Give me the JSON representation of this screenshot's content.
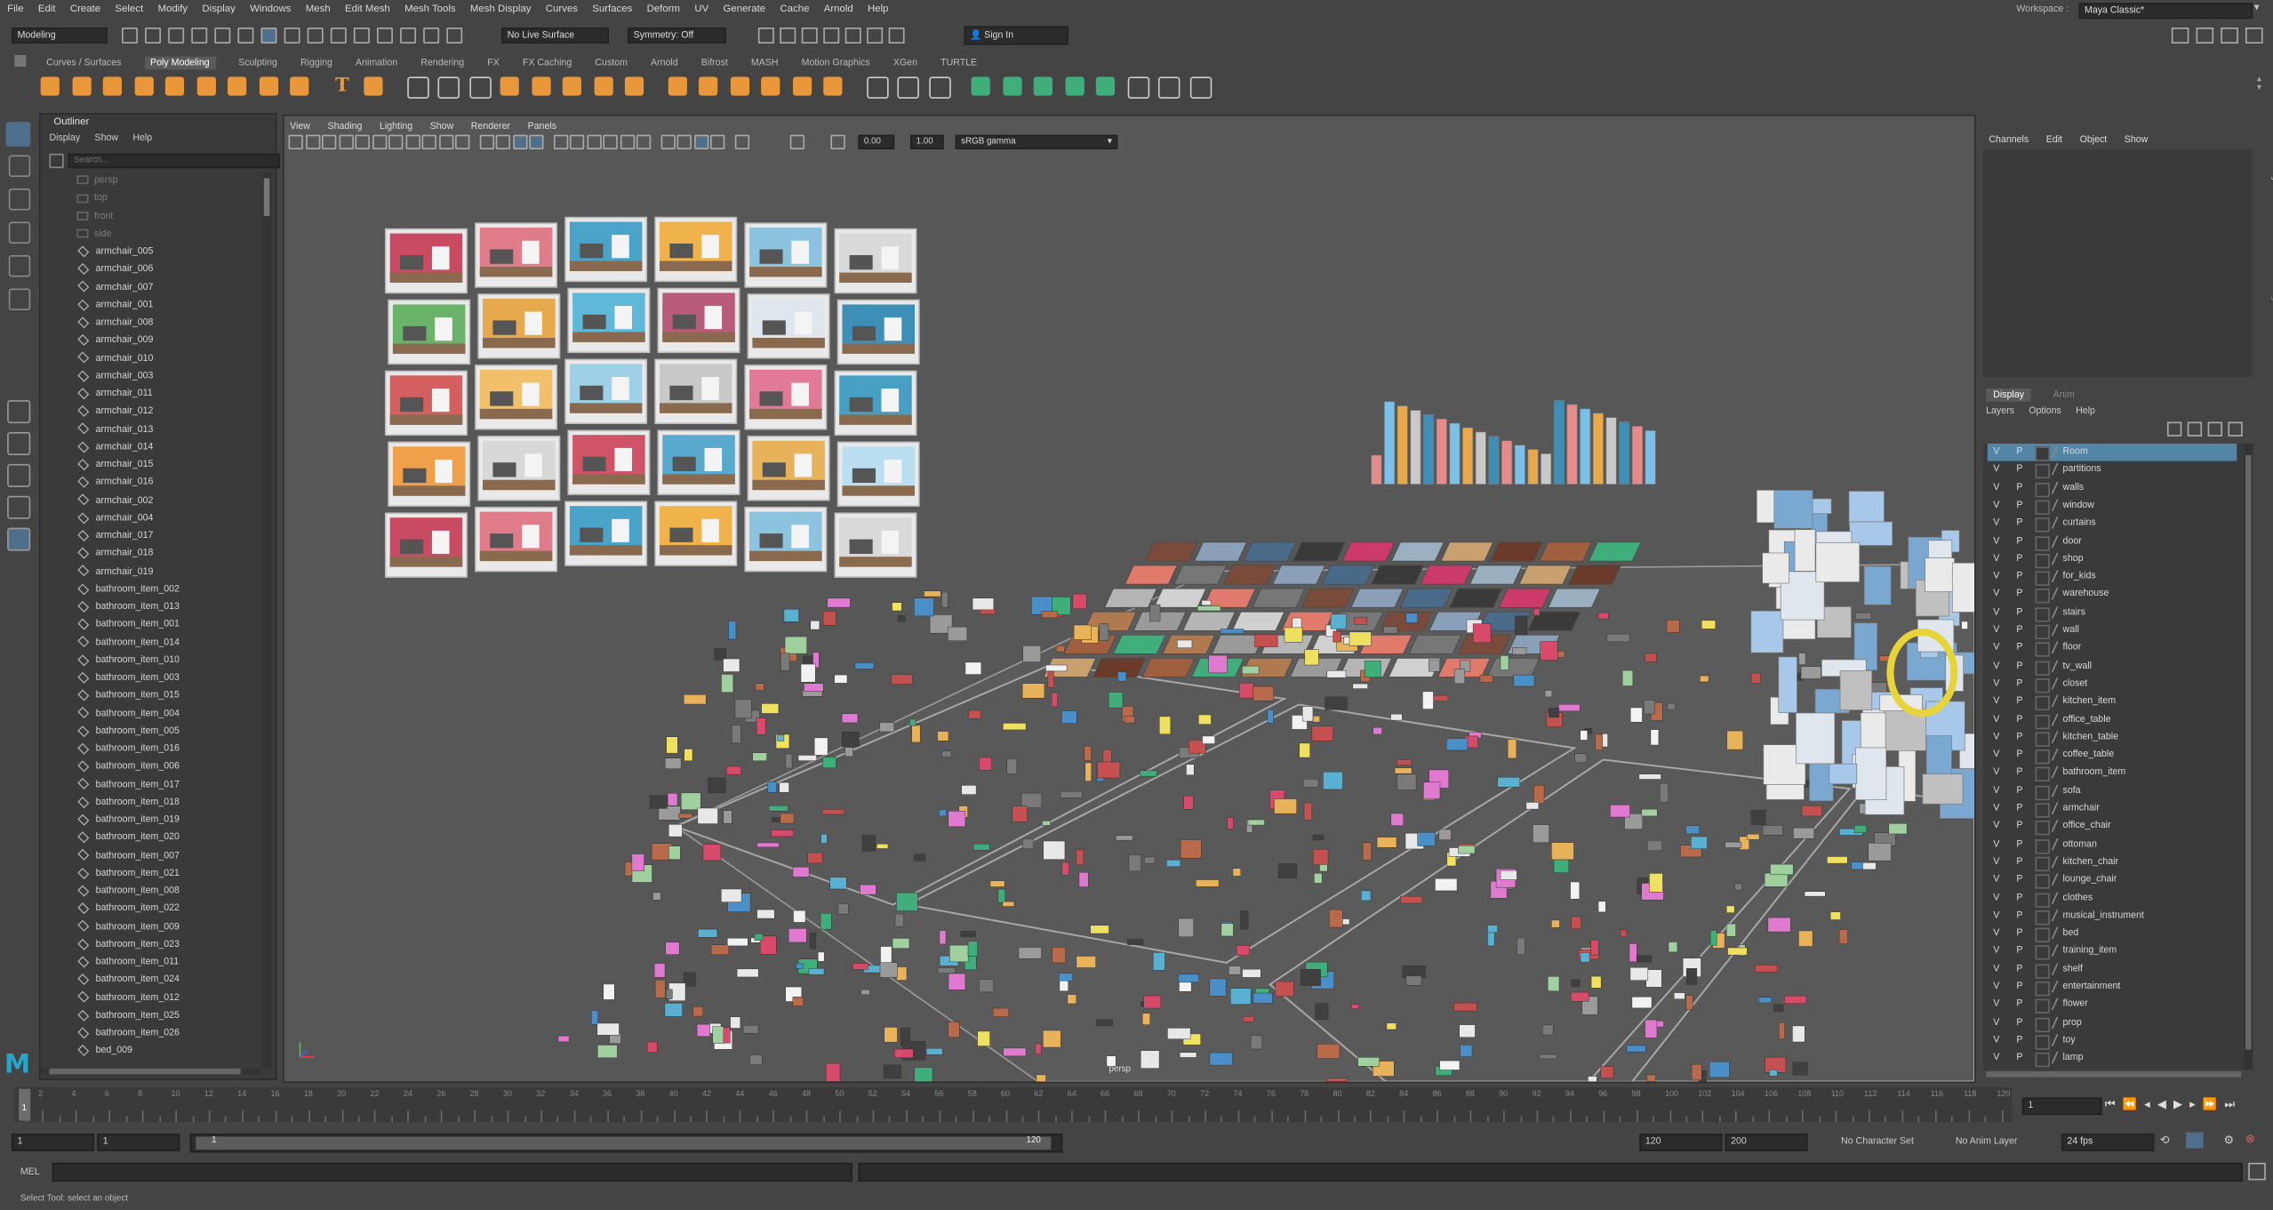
{
  "menu": [
    "File",
    "Edit",
    "Create",
    "Select",
    "Modify",
    "Display",
    "Windows",
    "Mesh",
    "Edit Mesh",
    "Mesh Tools",
    "Mesh Display",
    "Curves",
    "Surfaces",
    "Deform",
    "UV",
    "Generate",
    "Cache",
    "Arnold",
    "Help"
  ],
  "workspace": {
    "label": "Workspace :",
    "value": "Maya Classic*"
  },
  "statusline": {
    "mode": "Modeling",
    "live_surface": "No Live Surface",
    "symmetry": "Symmetry: Off",
    "sign_in": "Sign In"
  },
  "shelf_tabs": [
    "Curves / Surfaces",
    "Poly Modeling",
    "Sculpting",
    "Rigging",
    "Animation",
    "Rendering",
    "FX",
    "FX Caching",
    "Custom",
    "Arnold",
    "Bifrost",
    "MASH",
    "Motion Graphics",
    "XGen",
    "TURTLE"
  ],
  "shelf_active": "Poly Modeling",
  "outliner": {
    "title": "Outliner",
    "menu": [
      "Display",
      "Show",
      "Help"
    ],
    "search_placeholder": "Search...",
    "cameras": [
      "persp",
      "top",
      "front",
      "side"
    ],
    "items": [
      "armchair_005",
      "armchair_006",
      "armchair_007",
      "armchair_001",
      "armchair_008",
      "armchair_009",
      "armchair_010",
      "armchair_003",
      "armchair_011",
      "armchair_012",
      "armchair_013",
      "armchair_014",
      "armchair_015",
      "armchair_016",
      "armchair_002",
      "armchair_004",
      "armchair_017",
      "armchair_018",
      "armchair_019",
      "bathroom_item_002",
      "bathroom_item_013",
      "bathroom_item_001",
      "bathroom_item_014",
      "bathroom_item_010",
      "bathroom_item_003",
      "bathroom_item_015",
      "bathroom_item_004",
      "bathroom_item_005",
      "bathroom_item_016",
      "bathroom_item_006",
      "bathroom_item_017",
      "bathroom_item_018",
      "bathroom_item_019",
      "bathroom_item_020",
      "bathroom_item_007",
      "bathroom_item_021",
      "bathroom_item_008",
      "bathroom_item_022",
      "bathroom_item_009",
      "bathroom_item_023",
      "bathroom_item_011",
      "bathroom_item_024",
      "bathroom_item_012",
      "bathroom_item_025",
      "bathroom_item_026",
      "bed_009"
    ]
  },
  "viewport": {
    "menu": [
      "View",
      "Shading",
      "Lighting",
      "Show",
      "Renderer",
      "Panels"
    ],
    "field1": "0.00",
    "field2": "1.00",
    "color_space": "sRGB gamma",
    "camera_label": "persp"
  },
  "channel_box": {
    "menu": [
      "Channels",
      "Edit",
      "Object",
      "Show"
    ]
  },
  "layer_editor": {
    "tabs": [
      "Display",
      "Anim"
    ],
    "menu": [
      "Layers",
      "Options",
      "Help"
    ],
    "v": "V",
    "p": "P",
    "layers": [
      "Room",
      "partitions",
      "walls",
      "window",
      "curtains",
      "door",
      "shop",
      "for_kids",
      "warehouse",
      "stairs",
      "wall",
      "floor",
      "tv_wall",
      "closet",
      "kitchen_item",
      "office_table",
      "kitchen_table",
      "coffee_table",
      "bathroom_item",
      "sofa",
      "armchair",
      "office_chair",
      "ottoman",
      "kitchen_chair",
      "lounge_chair",
      "clothes",
      "musical_instrument",
      "bed",
      "training_item",
      "shelf",
      "entertainment",
      "flower",
      "prop",
      "toy",
      "lamp"
    ],
    "selected": "Room"
  },
  "side_tabs": [
    "Channel Box / Layer Editor",
    "Modeling Toolkit",
    "Attribute Editor"
  ],
  "timeline": {
    "labels": [
      "1",
      "2",
      "4",
      "6",
      "8",
      "10",
      "12",
      "14",
      "16",
      "18",
      "20",
      "22",
      "24",
      "26",
      "28",
      "30",
      "32",
      "34",
      "36",
      "38",
      "40",
      "42",
      "44",
      "46",
      "48",
      "50",
      "52",
      "54",
      "56",
      "58",
      "60",
      "62",
      "64",
      "66",
      "68",
      "70",
      "72",
      "74",
      "76",
      "78",
      "80",
      "82",
      "84",
      "86",
      "88",
      "90",
      "92",
      "94",
      "96",
      "98",
      "100",
      "102",
      "104",
      "106",
      "108",
      "110",
      "112",
      "114",
      "116",
      "118",
      "120"
    ],
    "current_frame": "1"
  },
  "range": {
    "start": "1",
    "inner_start": "1",
    "slider_start": "1",
    "slider_end": "120",
    "end": "120",
    "outer_end": "200",
    "character_set": "No Character Set",
    "anim_layer": "No Anim Layer",
    "fps": "24 fps"
  },
  "command": {
    "lang": "MEL"
  },
  "help_line": "Select Tool: select an object",
  "colors": {
    "accent": "#5285a6",
    "bg": "#444444",
    "panel": "#3a3a3a",
    "viewport": "#575757",
    "shelf_orange": "#e8973a",
    "shelf_green": "#3fae7a"
  }
}
